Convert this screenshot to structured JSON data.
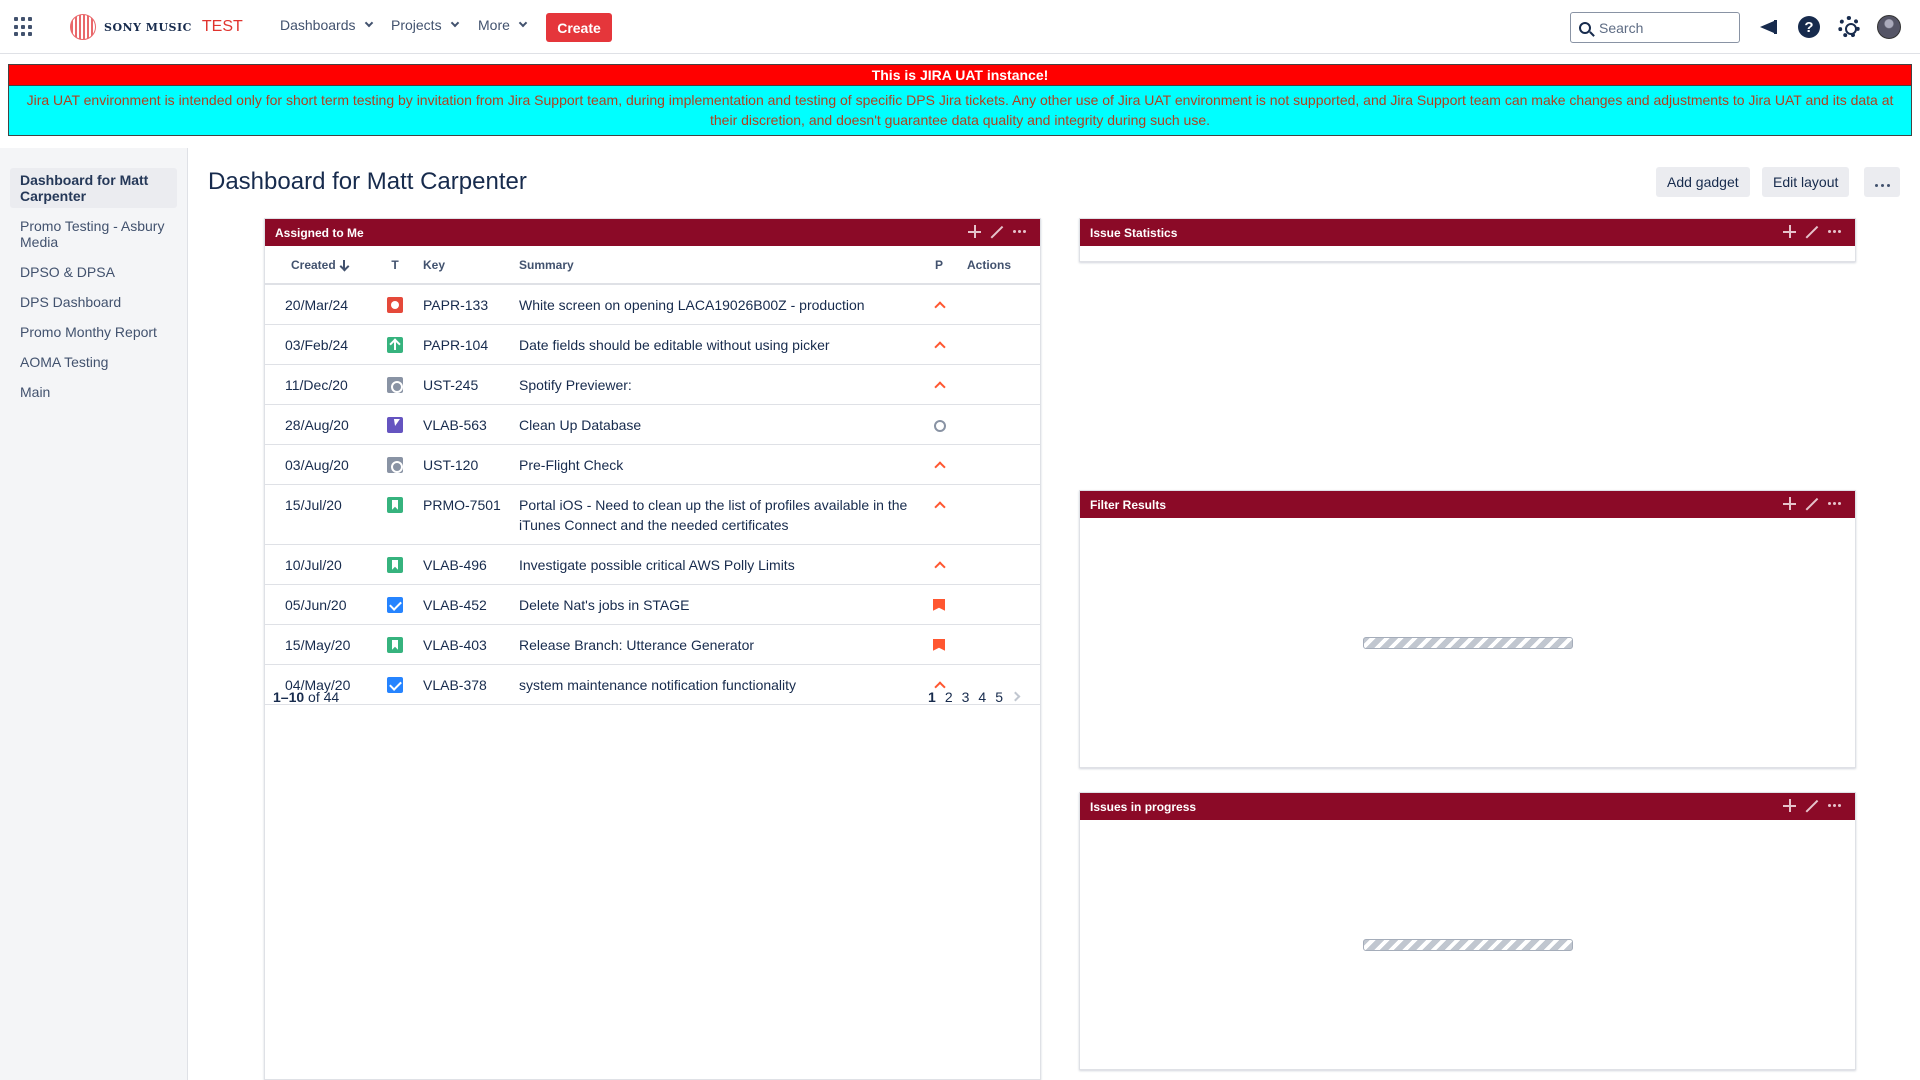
{
  "nav": {
    "logo_brand": "SONY MUSIC",
    "logo_env": "TEST",
    "items": [
      {
        "label": "Dashboards"
      },
      {
        "label": "Projects"
      },
      {
        "label": "More"
      }
    ],
    "create_label": "Create",
    "search_placeholder": "Search"
  },
  "banner": {
    "title": "This is JIRA UAT instance!",
    "body": "Jira UAT environment is intended only for short term testing by invitation from Jira Support team, during implementation and testing of specific DPS Jira tickets. Any other use of Jira UAT environment is not supported, and Jira Support team can make changes and adjustments to Jira UAT and its data at their discretion, and doesn't guarantee data quality and integrity during such use.",
    "title_color": "#ff0000",
    "body_color": "#00ffff"
  },
  "sidebar": {
    "items": [
      {
        "label": "Dashboard for Matt Carpenter",
        "active": true
      },
      {
        "label": "Promo Testing - Asbury Media"
      },
      {
        "label": "DPSO & DPSA"
      },
      {
        "label": "DPS Dashboard"
      },
      {
        "label": "Promo Monthy Report"
      },
      {
        "label": "AOMA Testing"
      },
      {
        "label": "Main"
      }
    ]
  },
  "page": {
    "title": "Dashboard for Matt Carpenter",
    "add_gadget": "Add gadget",
    "edit_layout": "Edit layout"
  },
  "gadget_header_color": "#8b0a27",
  "assigned": {
    "title": "Assigned to Me",
    "columns": {
      "created": "Created",
      "type": "T",
      "key": "Key",
      "summary": "Summary",
      "priority": "P",
      "actions": "Actions"
    },
    "rows": [
      {
        "created": "20/Mar/24",
        "type": "bug-icon",
        "key": "PAPR-133",
        "summary": "White screen on opening LACA19026B00Z - production",
        "priority": "high-priority-icon"
      },
      {
        "created": "03/Feb/24",
        "type": "improvement-icon",
        "key": "PAPR-104",
        "summary": "Date fields should be editable without using picker",
        "priority": "high-priority-icon"
      },
      {
        "created": "11/Dec/20",
        "type": "task-icon",
        "key": "UST-245",
        "summary": "Spotify Previewer:",
        "priority": "high-priority-icon"
      },
      {
        "created": "28/Aug/20",
        "type": "epic-icon",
        "key": "VLAB-563",
        "summary": "Clean Up Database",
        "priority": "medium-priority-icon"
      },
      {
        "created": "03/Aug/20",
        "type": "task-icon",
        "key": "UST-120",
        "summary": "Pre-Flight Check",
        "priority": "high-priority-icon"
      },
      {
        "created": "15/Jul/20",
        "type": "story-icon",
        "key": "PRMO-7501",
        "summary": "Portal iOS - Need to clean up the list of profiles available in the iTunes Connect and the needed certificates",
        "priority": "high-priority-icon"
      },
      {
        "created": "10/Jul/20",
        "type": "story-icon",
        "key": "VLAB-496",
        "summary": "Investigate possible critical AWS Polly Limits",
        "priority": "high-priority-icon"
      },
      {
        "created": "05/Jun/20",
        "type": "checkbox-icon",
        "key": "VLAB-452",
        "summary": "Delete Nat's jobs in STAGE",
        "priority": "blocker-flag-icon"
      },
      {
        "created": "15/May/20",
        "type": "story-icon",
        "key": "VLAB-403",
        "summary": "Release Branch: Utterance Generator",
        "priority": "blocker-flag-icon"
      },
      {
        "created": "04/May/20",
        "type": "checkbox-icon",
        "key": "VLAB-378",
        "summary": "system maintenance notification functionality",
        "priority": "high-priority-icon"
      }
    ],
    "pager": {
      "range": "1–10",
      "of_text": "of 44",
      "pages": [
        "1",
        "2",
        "3",
        "4",
        "5"
      ],
      "current": "1"
    }
  },
  "issue_statistics": {
    "title": "Issue Statistics"
  },
  "filter_results": {
    "title": "Filter Results"
  },
  "issues_in_progress": {
    "title": "Issues in progress"
  }
}
